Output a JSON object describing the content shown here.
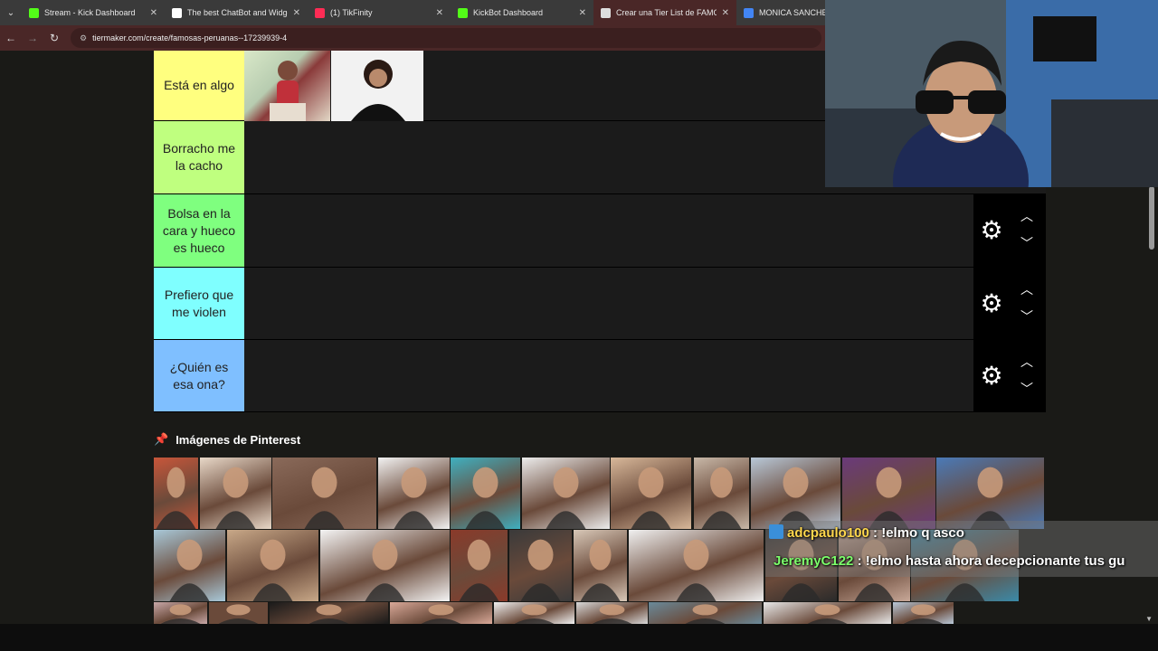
{
  "browser": {
    "tabs": [
      {
        "title": "Stream - Kick Dashboard",
        "icon": "kick-icon",
        "color": "#53fc18",
        "active": false
      },
      {
        "title": "The best ChatBot and Widgets",
        "icon": "diamond-icon",
        "color": "#ffffff",
        "active": false
      },
      {
        "title": "(1) TikFinity",
        "icon": "tikfinity-icon",
        "color": "#fe2c55",
        "active": false
      },
      {
        "title": "KickBot Dashboard",
        "icon": "kickbot-icon",
        "color": "#53fc18",
        "active": false
      },
      {
        "title": "Crear una Tier List de FAMOSAS",
        "icon": "tiermaker-icon",
        "color": "#dddddd",
        "active": true
      },
      {
        "title": "MONICA SANCHEZ -",
        "icon": "google-icon",
        "color": "#4285f4",
        "active": false
      }
    ],
    "url": "tiermaker.com/create/famosas-peruanas--17239939-4"
  },
  "tiers": [
    {
      "label": "Está en algo",
      "color": "#ffff7f"
    },
    {
      "label": "Borracho me la cacho",
      "color": "#bfff7f"
    },
    {
      "label": "Bolsa en la cara y hueco es hueco",
      "color": "#7fff7f"
    },
    {
      "label": "Prefiero que me violen",
      "color": "#7fffff"
    },
    {
      "label": "¿Quién es esa ona?",
      "color": "#7fbfff"
    }
  ],
  "pinterest": {
    "title": "Imágenes de Pinterest"
  },
  "chat": [
    {
      "user": "adcpaulo100",
      "message": " : !elmo q asco"
    },
    {
      "user": "JeremyC122",
      "message": " : !elmo hasta ahora decepcionante tus gu"
    }
  ]
}
